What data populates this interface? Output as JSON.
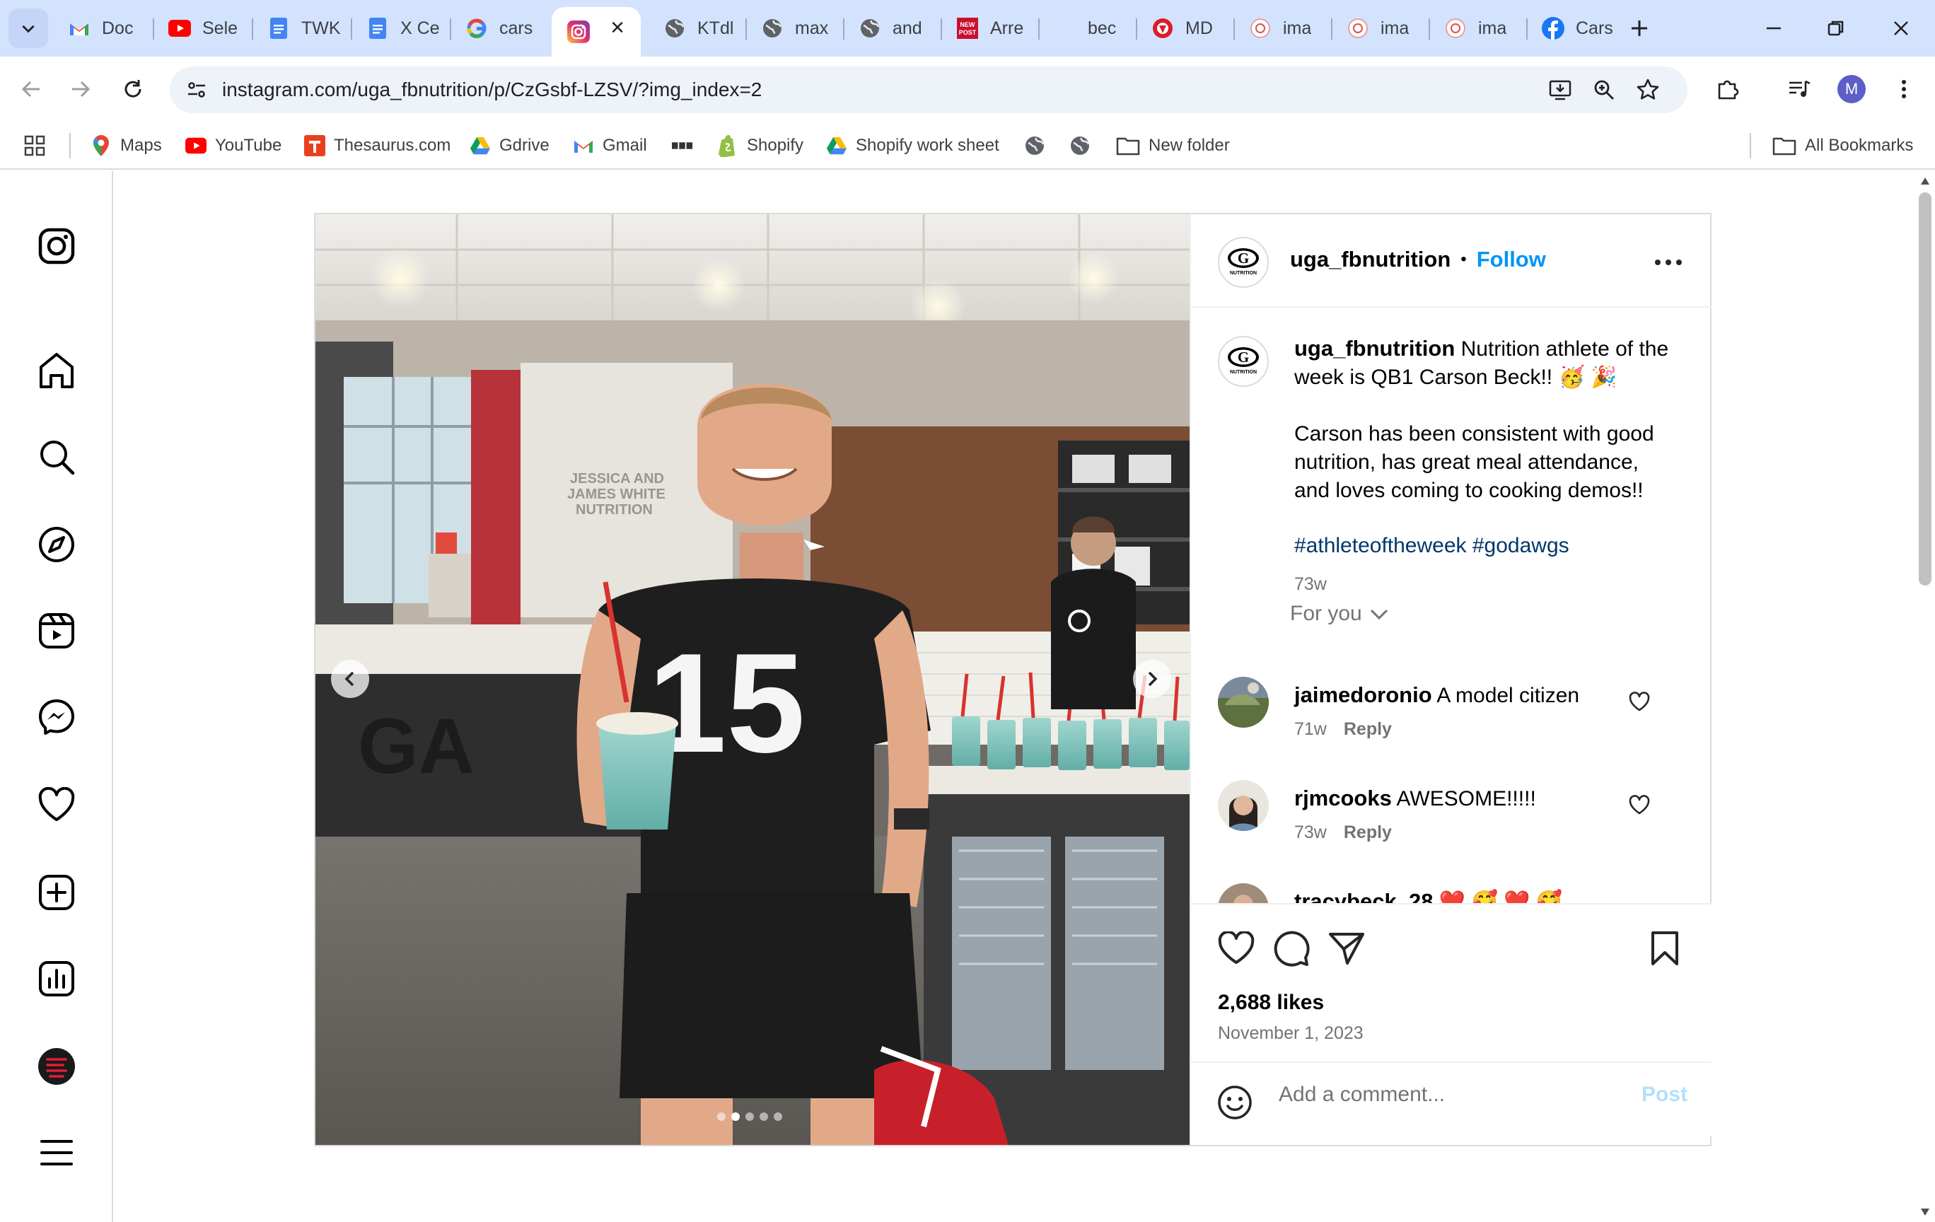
{
  "browser": {
    "tabs": [
      {
        "title": "Doc",
        "icon": "gmail-icon"
      },
      {
        "title": "Sele",
        "icon": "youtube-icon"
      },
      {
        "title": "TWK",
        "icon": "google-docs-icon"
      },
      {
        "title": "X Ce",
        "icon": "google-docs-icon"
      },
      {
        "title": "cars",
        "icon": "google-icon"
      },
      {
        "title": "",
        "icon": "instagram-icon",
        "active": true
      },
      {
        "title": "KTdl",
        "icon": "globe-icon"
      },
      {
        "title": "max",
        "icon": "globe-icon"
      },
      {
        "title": "and",
        "icon": "globe-icon"
      },
      {
        "title": "Arre",
        "icon": "nypost-icon"
      },
      {
        "title": "bec",
        "icon": "none"
      },
      {
        "title": "MD",
        "icon": "redsite-icon"
      },
      {
        "title": "ima",
        "icon": "image-site-icon"
      },
      {
        "title": "ima",
        "icon": "image-site-icon"
      },
      {
        "title": "ima",
        "icon": "image-site-icon"
      },
      {
        "title": "Cars",
        "icon": "facebook-icon"
      }
    ],
    "url": "instagram.com/uga_fbnutrition/p/CzGsbf-LZSV/?img_index=2",
    "profile_initial": "M",
    "bookmarks": [
      {
        "label": "Maps",
        "icon": "maps-icon"
      },
      {
        "label": "YouTube",
        "icon": "youtube-icon"
      },
      {
        "label": "Thesaurus.com",
        "icon": "thesaurus-icon"
      },
      {
        "label": "Gdrive",
        "icon": "gdrive-icon"
      },
      {
        "label": "Gmail",
        "icon": "gmail-icon"
      },
      {
        "label": "",
        "icon": "bbc-icon"
      },
      {
        "label": "Shopify",
        "icon": "shopify-icon"
      },
      {
        "label": "Shopify work sheet",
        "icon": "gdrive-icon"
      },
      {
        "label": "",
        "icon": "globe-icon"
      },
      {
        "label": "",
        "icon": "globe-icon"
      },
      {
        "label": "New folder",
        "icon": "folder-icon"
      }
    ],
    "all_bookmarks": "All Bookmarks"
  },
  "post": {
    "username": "uga_fbnutrition",
    "follow_label": "Follow",
    "separator": "•",
    "caption_line1": "Nutrition athlete of the week is QB1 Carson Beck!! 🥳 🎉",
    "caption_line2": "Carson has been consistent with good nutrition, has great meal attendance, and loves coming to cooking demos!!",
    "hashtags": "#athleteoftheweek #godawgs",
    "caption_time": "73w",
    "sort_label": "For you",
    "comments": [
      {
        "user": "jaimedoronio",
        "text": "A model citizen",
        "time": "71w",
        "reply": "Reply"
      },
      {
        "user": "rjmcooks",
        "text": "AWESOME!!!!!",
        "time": "73w",
        "reply": "Reply"
      },
      {
        "user": "tracybeck_28",
        "text": "❤️ 🥰 ❤️ 🥰",
        "time": "",
        "reply": ""
      }
    ],
    "likes": "2,688 likes",
    "date": "November 1, 2023",
    "add_comment_placeholder": "Add a comment...",
    "post_label": "Post",
    "avatar_text": "NUTRITION",
    "jersey_number": "15",
    "carousel_total": 5,
    "carousel_active": 2
  }
}
